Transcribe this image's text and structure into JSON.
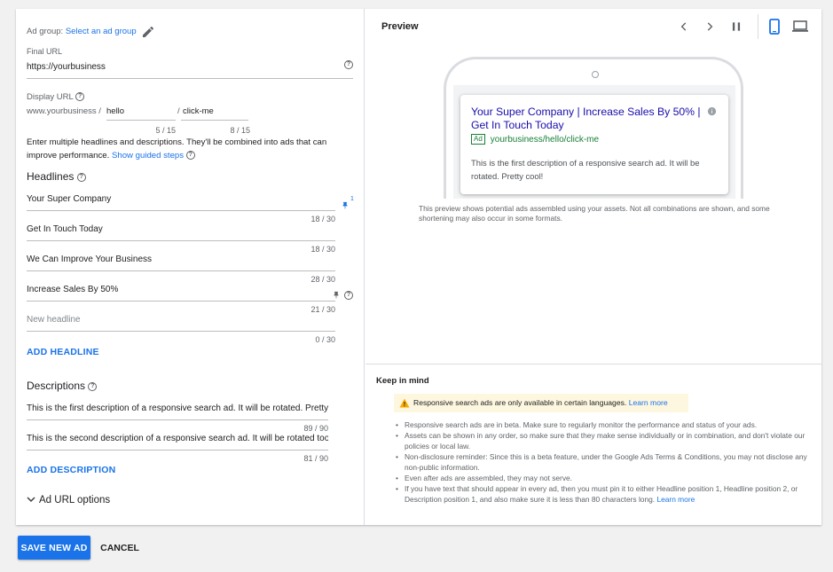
{
  "ad_group": {
    "label": "Ad group:",
    "link": "Select an ad group",
    "edit_icon": "pencil-icon"
  },
  "final_url": {
    "label": "Final URL",
    "value": "https://yourbusiness"
  },
  "display_url": {
    "label": "Display URL",
    "base": "www.yourbusiness /",
    "path1": "hello",
    "separator": "/",
    "path2": "click-me",
    "path1_count": "5 / 15",
    "path2_count": "8 / 15"
  },
  "info": {
    "text": "Enter multiple headlines and descriptions. They'll be combined into ads that can improve performance.",
    "link": "Show guided steps"
  },
  "headlines": {
    "title": "Headlines",
    "items": [
      {
        "value": "Your Super Company",
        "count": "18 / 30",
        "pin_badge": "1"
      },
      {
        "value": "Get In Touch Today",
        "count": "18 / 30"
      },
      {
        "value": "We Can Improve Your Business",
        "count": "28 / 30"
      },
      {
        "value": "Increase Sales By 50%",
        "count": "21 / 30"
      }
    ],
    "new_placeholder": "New headline",
    "new_count": "0 / 30",
    "add_label": "ADD HEADLINE"
  },
  "descriptions": {
    "title": "Descriptions",
    "items": [
      {
        "value": "This is the first description of a responsive search ad. It will be rotated. Pretty cool!",
        "count": "89 / 90"
      },
      {
        "value": "This is the second description of a responsive search ad. It will be rotated too.",
        "count": "81 / 90"
      }
    ],
    "add_label": "ADD DESCRIPTION"
  },
  "url_options": {
    "label": "Ad URL options"
  },
  "preview": {
    "title": "Preview",
    "ad_title": "Your Super Company | Increase Sales By 50% | Get In Touch Today",
    "ad_badge": "Ad",
    "ad_url": "yourbusiness/hello/click-me",
    "ad_desc": "This is the first description of a responsive search ad. It will be rotated. Pretty cool!",
    "note": "This preview shows potential ads assembled using your assets. Not all combinations are shown, and some shortening may also occur in some formats."
  },
  "keep_in_mind": {
    "title": "Keep in mind",
    "warning": "Responsive search ads are only available in certain languages.",
    "warning_link": "Learn more",
    "bullets": [
      "Responsive search ads are in beta. Make sure to regularly monitor the performance and status of your ads.",
      "Assets can be shown in any order, so make sure that they make sense individually or in combination, and don't violate our policies or local law.",
      "Non-disclosure reminder: Since this is a beta feature, under the Google Ads Terms & Conditions, you may not disclose any non-public information.",
      "Even after ads are assembled, they may not serve."
    ],
    "last_bullet": "If you have text that should appear in every ad, then you must pin it to either Headline position 1, Headline position 2, or Description position 1, and also make sure it is less than 80 characters long.",
    "last_link": "Learn more"
  },
  "buttons": {
    "save": "SAVE NEW AD",
    "cancel": "CANCEL"
  },
  "colors": {
    "accent": "#1a73e8",
    "ad_green": "#188038",
    "warning_bg": "#fef7e0"
  }
}
